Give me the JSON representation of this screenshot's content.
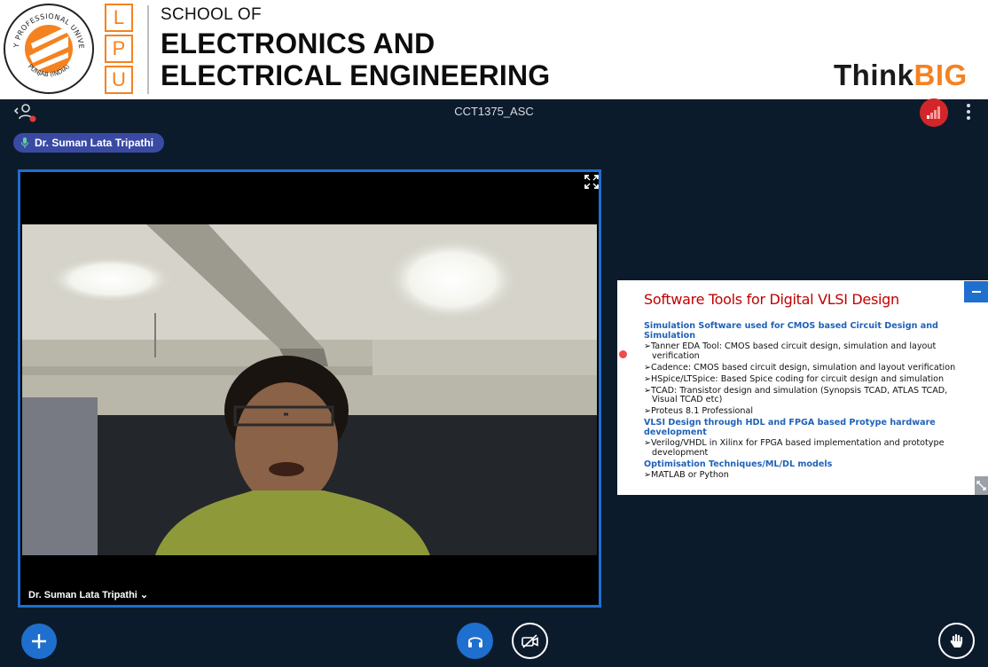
{
  "header": {
    "seal_text_top": "LOVELY PROFESSIONAL UNIVERSITY",
    "seal_text_bottom": "PUNJAB (INDIA)",
    "lpu_letters": [
      "L",
      "P",
      "U"
    ],
    "school_of": "SCHOOL OF",
    "school_line1": "ELECTRONICS AND",
    "school_line2": "ELECTRICAL ENGINEERING",
    "tagline_think": "Think",
    "tagline_big": "BIG"
  },
  "session": {
    "title": "CCT1375_ASC"
  },
  "talking_indicator": {
    "name": "Dr. Suman Lata Tripathi"
  },
  "webcam": {
    "name": "Dr. Suman Lata Tripathi",
    "name_suffix": "⌄"
  },
  "slide": {
    "title": "Software Tools for Digital VLSI Design",
    "sections": [
      {
        "heading": "Simulation Software used for CMOS based Circuit Design and Simulation",
        "items": [
          "➢Tanner EDA Tool: CMOS based circuit design, simulation and layout verification",
          "➢Cadence: CMOS based circuit design, simulation and layout verification",
          "➢HSpice/LTSpice: Based Spice coding for circuit design and simulation",
          "➢TCAD: Transistor design and simulation (Synopsis TCAD, ATLAS TCAD, Visual TCAD etc)",
          "➢Proteus 8.1 Professional"
        ]
      },
      {
        "heading": "VLSI Design through HDL and FPGA based Protype hardware development",
        "items": [
          "➢Verilog/VHDL in Xilinx for FPGA based implementation and prototype development"
        ]
      },
      {
        "heading": "Optimisation Techniques/ML/DL models",
        "items": [
          "➢MATLAB or Python"
        ]
      }
    ]
  },
  "colors": {
    "accent": "#1f6fcf",
    "alert": "#d3262a",
    "brand_orange": "#f58220",
    "background": "#0c1b2c",
    "slide_title": "#c00000",
    "slide_heading": "#1f62b8"
  },
  "icons": {
    "user_menu": "user-back-icon",
    "connection": "signal-bars-icon",
    "more": "vertical-dots-icon",
    "mic": "microphone-icon",
    "expand": "expand-arrows-icon",
    "add": "plus-icon",
    "audio": "headphones-icon",
    "video": "camera-off-icon",
    "hand": "raise-hand-icon"
  }
}
